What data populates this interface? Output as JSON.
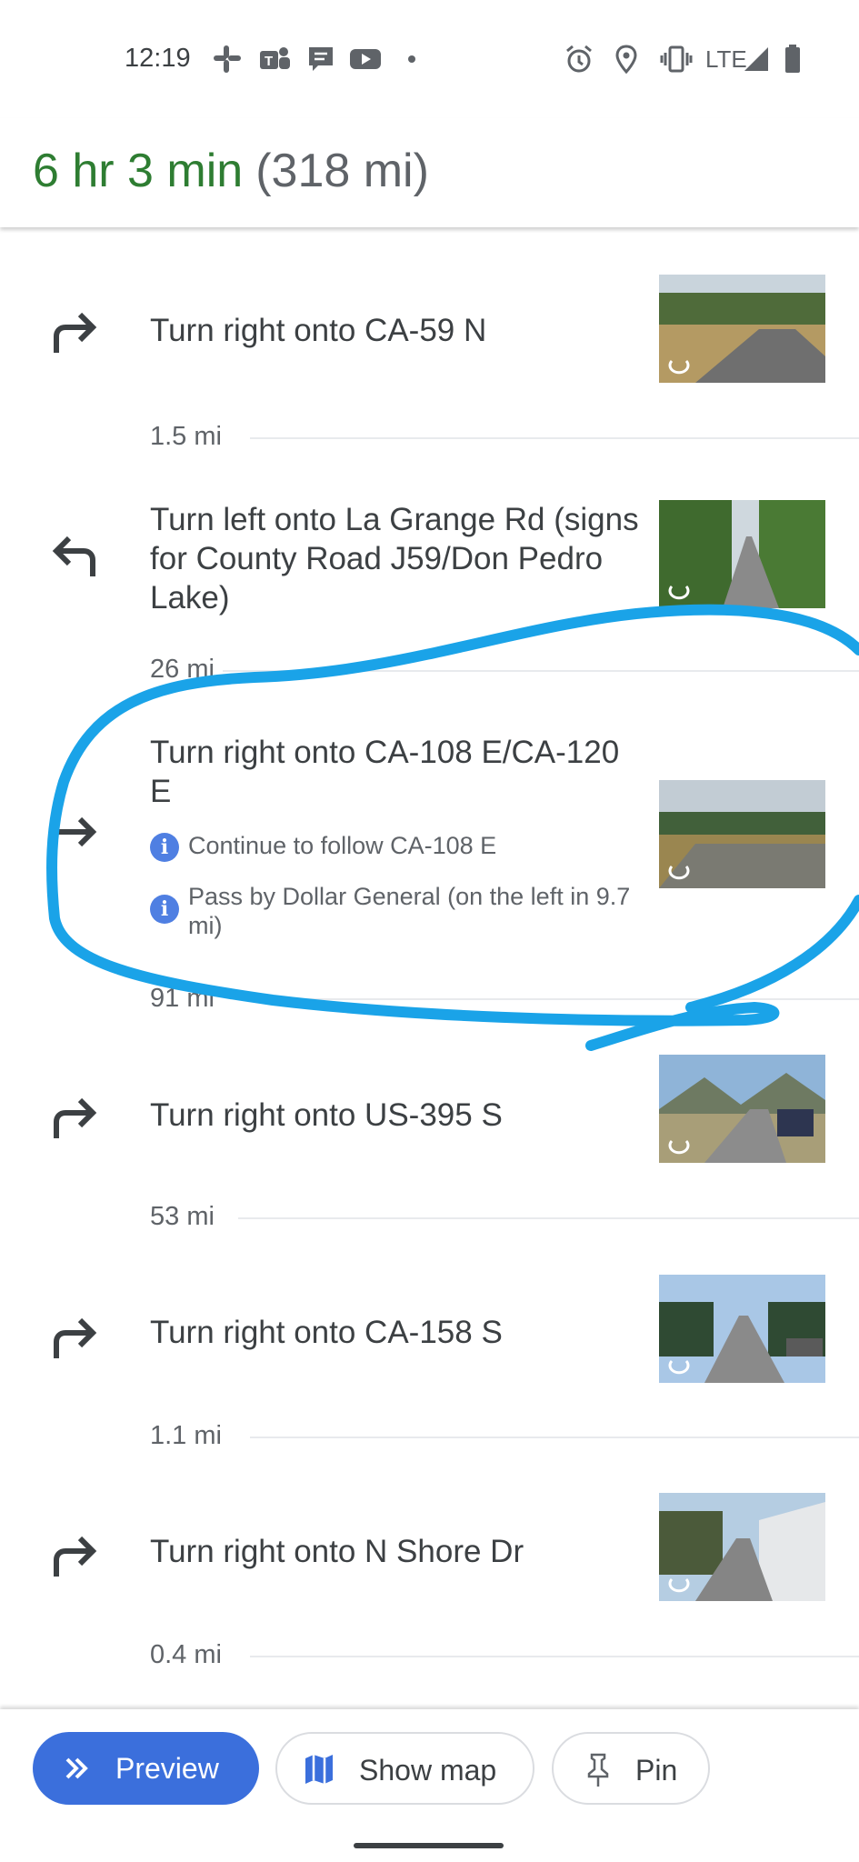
{
  "status_bar": {
    "time": "12:19",
    "left_icons": [
      "slack-icon",
      "teams-icon",
      "messages-icon",
      "youtube-icon",
      "dot-icon"
    ],
    "right_icons": [
      "alarm-icon",
      "location-icon",
      "vibrate-icon"
    ],
    "network": "LTE"
  },
  "header": {
    "duration": "6 hr 3 min",
    "distance": "(318 mi)"
  },
  "steps": [
    {
      "instruction": "Turn right onto CA-59 N",
      "icon": "turn-right-icon",
      "distance_after": "1.5 mi"
    },
    {
      "instruction": "Turn left onto La Grange Rd (signs for County Road J59/Don Pedro Lake)",
      "icon": "turn-left-icon",
      "distance_after": "26 mi"
    },
    {
      "instruction": "Turn right onto CA-108 E/CA-120 E",
      "icon": "turn-right-icon",
      "notes": [
        "Continue to follow CA-108 E",
        "Pass by Dollar General (on the left in 9.7 mi)"
      ],
      "distance_after": "91 mi"
    },
    {
      "instruction": "Turn right onto US-395 S",
      "icon": "turn-right-icon",
      "distance_after": "53 mi"
    },
    {
      "instruction": "Turn right onto CA-158 S",
      "icon": "turn-right-icon",
      "distance_after": "1.1 mi"
    },
    {
      "instruction": "Turn right onto N Shore Dr",
      "icon": "turn-right-icon",
      "distance_after": "0.4 mi"
    }
  ],
  "bottom_bar": {
    "preview_label": "Preview",
    "show_map_label": "Show map",
    "pin_label": "Pin"
  },
  "colors": {
    "duration_green": "#2e7d32",
    "accent_blue": "#3b6fdc",
    "scribble_blue": "#1aa3e8"
  }
}
